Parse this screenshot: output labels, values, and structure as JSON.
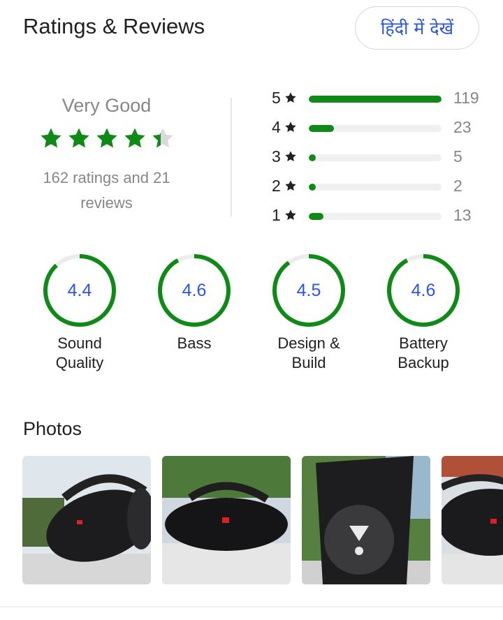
{
  "header": {
    "title": "Ratings & Reviews",
    "lang_button": "हिंदी में देखें"
  },
  "summary": {
    "label": "Very Good",
    "rating": 4.4,
    "star_count": 5,
    "count_text": "162 ratings and 21 reviews"
  },
  "distribution": [
    {
      "stars": "5",
      "count": "119",
      "fraction": 1.0
    },
    {
      "stars": "4",
      "count": "23",
      "fraction": 0.19
    },
    {
      "stars": "3",
      "count": "5",
      "fraction": 0.04
    },
    {
      "stars": "2",
      "count": "2",
      "fraction": 0.02
    },
    {
      "stars": "1",
      "count": "13",
      "fraction": 0.11
    }
  ],
  "aspects": [
    {
      "value": "4.4",
      "label_lines": [
        "Sound",
        "Quality"
      ],
      "score": 4.4
    },
    {
      "value": "4.6",
      "label_lines": [
        "Bass"
      ],
      "score": 4.6
    },
    {
      "value": "4.5",
      "label_lines": [
        "Design &",
        "Build"
      ],
      "score": 4.5
    },
    {
      "value": "4.6",
      "label_lines": [
        "Battery",
        "Backup"
      ],
      "score": 4.6
    }
  ],
  "photos": {
    "title": "Photos",
    "count_visible": 4
  },
  "colors": {
    "accent_green": "#0f8a17",
    "link_blue": "#2a55e5",
    "muted_text": "#878787",
    "track_gray": "#f0f0f0"
  }
}
